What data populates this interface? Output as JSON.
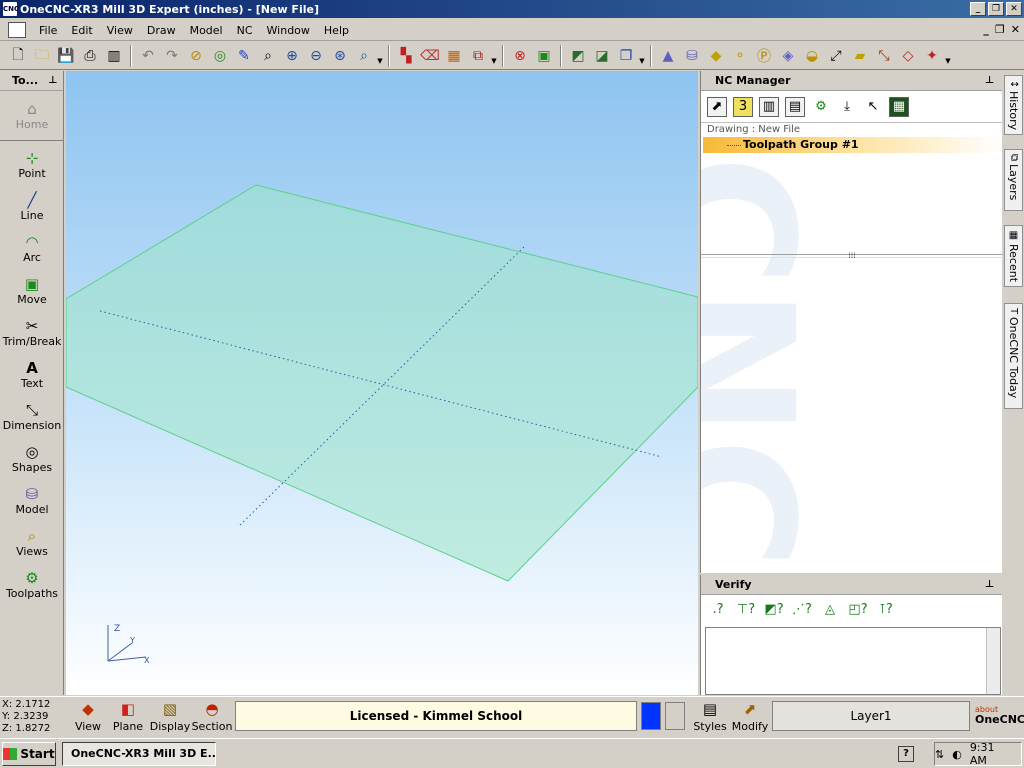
{
  "window": {
    "title": "OneCNC-XR3 Mill 3D Expert (inches) - [New File]",
    "app_icon_text": "CNC",
    "buttons": [
      "minimize-icon",
      "restore-icon",
      "close-icon"
    ]
  },
  "menu": {
    "items": [
      "File",
      "Edit",
      "View",
      "Draw",
      "Model",
      "NC",
      "Window",
      "Help"
    ],
    "underlined_letters": [
      "F",
      "E",
      "V",
      "D",
      "M",
      "N",
      "W",
      "H"
    ]
  },
  "toolbar": {
    "icons": [
      "new-file-icon",
      "open-folder-icon",
      "save-icon",
      "print-icon",
      "preview-icon",
      "undo-icon",
      "redo-icon",
      "regen-icon",
      "zoom-all-icon",
      "pencil-icon",
      "zoom-window-icon",
      "zoom-in-icon",
      "zoom-out-icon",
      "zoom-fit-icon",
      "zoom-previous-icon",
      "snap-icon",
      "erase-icon",
      "grid-icon",
      "layers-icon",
      "cancel-icon",
      "select-icon",
      "trim-icon",
      "trim-extend-icon",
      "copy-icon",
      "cone-icon",
      "cylinder-icon",
      "solid-icon",
      "spheres-icon",
      "parking-icon",
      "box-icon",
      "sphere-half-icon",
      "axis-icon",
      "plate-icon",
      "tool-icon",
      "toolpath-icon",
      "transform-icon"
    ]
  },
  "left_panel": {
    "header": "To...",
    "tools": [
      {
        "label": "Home",
        "icon": "home-icon",
        "glyph": "⌂"
      },
      {
        "label": "Point",
        "icon": "point-icon",
        "glyph": "⊹"
      },
      {
        "label": "Line",
        "icon": "line-icon",
        "glyph": "╱"
      },
      {
        "label": "Arc",
        "icon": "arc-icon",
        "glyph": "◠"
      },
      {
        "label": "Move",
        "icon": "move-icon",
        "glyph": "▣"
      },
      {
        "label": "Trim/Break",
        "icon": "scissors-icon",
        "glyph": "✂"
      },
      {
        "label": "Text",
        "icon": "text-icon",
        "glyph": "A"
      },
      {
        "label": "Dimension",
        "icon": "dimension-icon",
        "glyph": "⤡"
      },
      {
        "label": "Shapes",
        "icon": "shapes-icon",
        "glyph": "◎"
      },
      {
        "label": "Model",
        "icon": "model-icon",
        "glyph": "⛁"
      },
      {
        "label": "Views",
        "icon": "magnifier-icon",
        "glyph": "⌕"
      },
      {
        "label": "Toolpaths",
        "icon": "toolpaths-icon",
        "glyph": "⚙"
      }
    ]
  },
  "viewport": {
    "axis_labels": {
      "z": "Z",
      "y": "Y",
      "x": "X"
    },
    "plane_color": "#9ee6c8"
  },
  "nc_manager": {
    "header": "NC Manager",
    "toolbar_icons": [
      "export-icon",
      "level-3-icon",
      "setup-icon",
      "tool-list-icon",
      "operation-icon",
      "download-icon",
      "pointer-icon",
      "dnc-icon"
    ],
    "toolbar_glyphs": [
      "⬈",
      "3",
      "▥",
      "▤",
      "⚙",
      "⤓",
      "↖",
      "▦"
    ],
    "drawing_label": "Drawing : New File",
    "group_label": "Toolpath Group #1",
    "splitter_glyph": "⁞⁞⁞",
    "watermark": "CNC"
  },
  "verify": {
    "header": "Verify",
    "icons": [
      "verify-question-icon",
      "verify-tool-icon",
      "verify-shade-icon",
      "verify-path-icon",
      "verify-solid-icon",
      "verify-stock-icon",
      "verify-probe-icon"
    ],
    "glyphs": [
      ".?",
      "⊤?",
      "◩?",
      "⋰?",
      "◬",
      "◰?",
      "⊺?"
    ]
  },
  "right_tabs": [
    {
      "label": "History",
      "icon": "history-icon",
      "glyph": "↕"
    },
    {
      "label": "Layers",
      "icon": "layers-icon",
      "glyph": "⧉"
    },
    {
      "label": "Recent",
      "icon": "recent-icon",
      "glyph": "▦"
    },
    {
      "label": "OneCNC Today",
      "icon": "today-icon",
      "glyph": "T"
    }
  ],
  "status": {
    "x": "X: 2.1712",
    "y": "Y: 2.3239",
    "z": "Z: 1.8272",
    "buttons": [
      "View",
      "Plane",
      "Display",
      "Section"
    ],
    "license": "Licensed - Kimmel School",
    "styles_label": "Styles",
    "modify_label": "Modify",
    "layer": "Layer1",
    "about_small": "about",
    "about_brand": "OneCNC",
    "swatch_color": "#0033ff"
  },
  "taskbar": {
    "start": "Start",
    "task_label": "OneCNC-XR3 Mill 3D E...",
    "help": "?",
    "time": "9:31 AM"
  }
}
